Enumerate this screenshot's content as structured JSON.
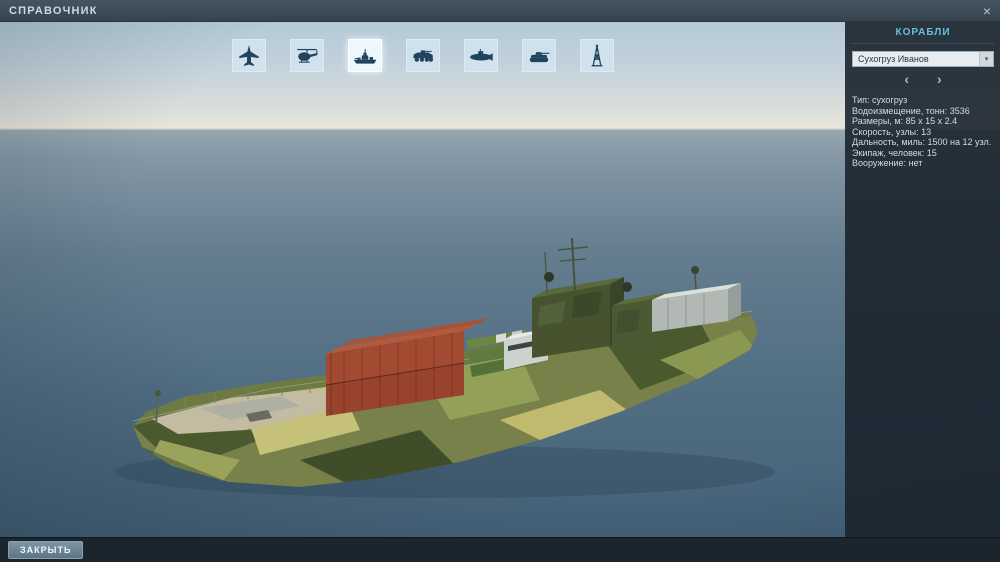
{
  "window": {
    "title": "СПРАВОЧНИК",
    "close_glyph": "×"
  },
  "categories": [
    {
      "id": "aircraft",
      "icon": "fighter-jet-icon",
      "selected": false
    },
    {
      "id": "helicopters",
      "icon": "helicopter-icon",
      "selected": false
    },
    {
      "id": "ships",
      "icon": "warship-icon",
      "selected": true
    },
    {
      "id": "vehicles",
      "icon": "apc-icon",
      "selected": false
    },
    {
      "id": "submarines",
      "icon": "submarine-icon",
      "selected": false
    },
    {
      "id": "tanks",
      "icon": "tank-icon",
      "selected": false
    },
    {
      "id": "structures",
      "icon": "derrick-tower-icon",
      "selected": false
    }
  ],
  "panel": {
    "title": "КОРАБЛИ",
    "dropdown": {
      "value": "Сухогруз Иванов",
      "arrow_glyph": "▾"
    },
    "prev_glyph": "‹",
    "next_glyph": "›",
    "specs": [
      {
        "label": "Тип:",
        "value": "сухогруз"
      },
      {
        "label": "Водоизмещение, тонн:",
        "value": "3536"
      },
      {
        "label": "Размеры, м:",
        "value": "85 х 15 х 2.4"
      },
      {
        "label": "Скорость, узлы:",
        "value": "13"
      },
      {
        "label": "Дальность, миль:",
        "value": "1500 на 12 узл."
      },
      {
        "label": "Экипаж, человек:",
        "value": "15"
      },
      {
        "label": "Вооружение:",
        "value": "нет"
      }
    ]
  },
  "footer": {
    "close_button": "ЗАКРЫТЬ"
  },
  "colors": {
    "accent_cyan": "#66bfdf",
    "titlebar": "#3b4a56",
    "panel_bg": "#19232c",
    "sky": "#adc4d4",
    "sea": "#4e6b80",
    "camo_green": "#4a5a2e",
    "container_red": "#97432e"
  }
}
